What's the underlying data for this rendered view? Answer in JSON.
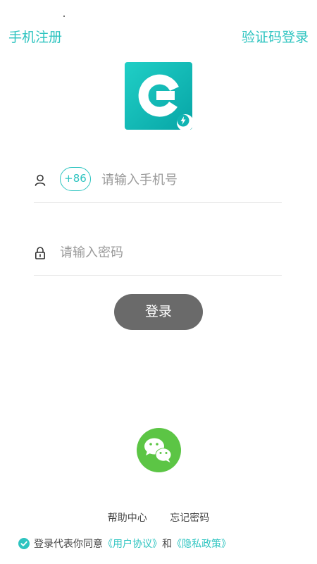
{
  "header": {
    "phone_register": "手机注册",
    "code_login": "验证码登录"
  },
  "logo": {
    "icon": "app-logo-g-icon",
    "badge_icon": "lightning-badge-icon"
  },
  "phone_field": {
    "icon": "user-icon",
    "country_code": "+86",
    "placeholder": "请输入手机号",
    "value": ""
  },
  "password_field": {
    "icon": "lock-icon",
    "placeholder": "请输入密码",
    "value": ""
  },
  "login_button": "登录",
  "social": {
    "wechat_icon": "wechat-icon"
  },
  "footer": {
    "help_center": "帮助中心",
    "forgot_password": "忘记密码",
    "agreement_prefix": "登录代表你同意",
    "user_agreement": "《用户协议》",
    "and": "和",
    "privacy_policy": "《隐私政策》"
  },
  "colors": {
    "accent": "#2ec4c0",
    "logo_gradient_start": "#20cfc6",
    "logo_gradient_end": "#07a5a6",
    "login_button_bg": "#6a6a6a",
    "wechat_green": "#5cc545"
  }
}
